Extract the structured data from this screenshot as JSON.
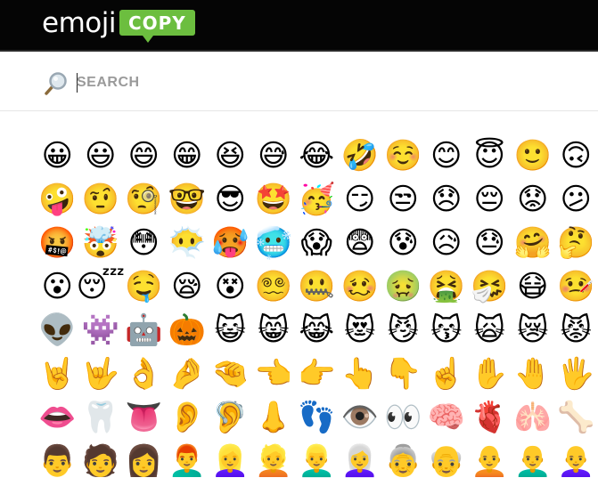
{
  "header": {
    "logo_word": "emoji",
    "logo_badge": "COPY",
    "colors": {
      "background": "#050505",
      "badge": "#6cbe3f"
    }
  },
  "search": {
    "icon": "magnifier-icon",
    "placeholder": "SEARCH",
    "value": ""
  },
  "emoji_rows": [
    [
      "😀",
      "😃",
      "😄",
      "😁",
      "😆",
      "😅",
      "😂",
      "🤣",
      "☺️",
      "😊",
      "😇",
      "🙂",
      "🙃"
    ],
    [
      "🤪",
      "🤨",
      "🧐",
      "🤓",
      "😎",
      "🤩",
      "🥳",
      "😏",
      "😒",
      "😞",
      "😔",
      "😟",
      "😕"
    ],
    [
      "🤬",
      "🤯",
      "😳",
      "😶‍🌫️",
      "🥵",
      "🥶",
      "😱",
      "😨",
      "😰",
      "😥",
      "😓",
      "🤗",
      "🤔"
    ],
    [
      "😮",
      "😴",
      "🤤",
      "😪",
      "😵",
      "😵‍💫",
      "🤐",
      "🥴",
      "🤢",
      "🤮",
      "🤧",
      "😷",
      "🤒"
    ],
    [
      "👽",
      "👾",
      "🤖",
      "🎃",
      "😺",
      "😸",
      "😹",
      "😻",
      "😼",
      "😽",
      "🙀",
      "😿",
      "😾"
    ],
    [
      "🤘",
      "🤟",
      "👌",
      "🤌",
      "🤏",
      "👈",
      "👉",
      "👆",
      "👇",
      "☝️",
      "✋",
      "🤚",
      "🖐️"
    ],
    [
      "👄",
      "🦷",
      "👅",
      "👂",
      "🦻",
      "👃",
      "👣",
      "👁️",
      "👀",
      "🧠",
      "🫀",
      "🫁",
      "🦴"
    ],
    [
      "👨",
      "🧑",
      "👩",
      "👨‍🦰",
      "👱‍♀️",
      "👱",
      "👱‍♂️",
      "👩‍🦳",
      "👵",
      "👴",
      "🧑‍🦲",
      "👨‍🦲",
      "👩‍🦲"
    ]
  ]
}
